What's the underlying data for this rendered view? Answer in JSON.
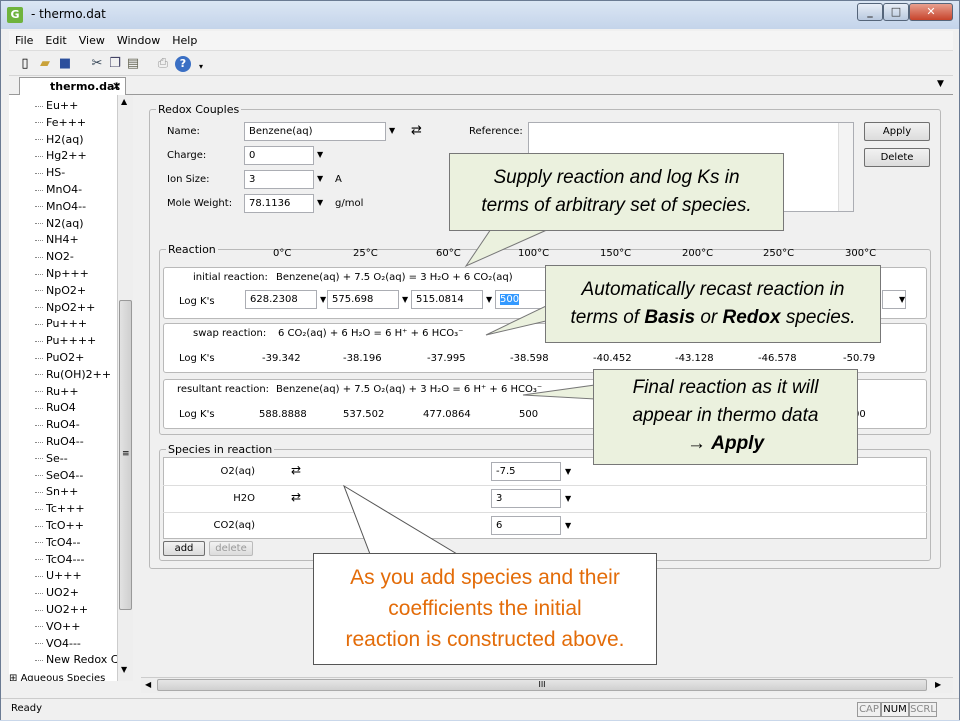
{
  "window": {
    "title": "- thermo.dat",
    "app_icon": "G"
  },
  "menu": [
    "File",
    "Edit",
    "View",
    "Window",
    "Help"
  ],
  "tab": {
    "label": "thermo.dat",
    "close": "✕"
  },
  "sidebar": {
    "items": [
      "Eu++",
      "Fe+++",
      "H2(aq)",
      "Hg2++",
      "HS-",
      "MnO4-",
      "MnO4--",
      "N2(aq)",
      "NH4+",
      "NO2-",
      "Np+++",
      "NpO2+",
      "NpO2++",
      "Pu+++",
      "Pu++++",
      "PuO2+",
      "Ru(OH)2++",
      "Ru++",
      "RuO4",
      "RuO4-",
      "RuO4--",
      "Se--",
      "SeO4--",
      "Sn++",
      "Tc+++",
      "TcO++",
      "TcO4--",
      "TcO4---",
      "U+++",
      "UO2+",
      "UO2++",
      "VO++",
      "VO4---",
      "New Redox C",
      "Aqueous Species"
    ]
  },
  "redox": {
    "legend": "Redox Couples",
    "name_label": "Name:",
    "name_value": "Benzene(aq)",
    "charge_label": "Charge:",
    "charge_value": "0",
    "ionsize_label": "Ion Size:",
    "ionsize_value": "3",
    "ionsize_unit": "A",
    "moleweight_label": "Mole Weight:",
    "moleweight_value": "78.1136",
    "moleweight_unit": "g/mol",
    "reference_label": "Reference:",
    "apply": "Apply",
    "delete": "Delete"
  },
  "reaction": {
    "legend": "Reaction",
    "temps": [
      "0°C",
      "25°C",
      "60°C",
      "100°C",
      "150°C",
      "200°C",
      "250°C",
      "300°C"
    ],
    "initial_label": "initial reaction:",
    "initial_eq": "Benzene(aq)  + 7.5 O₂(aq)  = 3 H₂O  + 6 CO₂(aq)",
    "logk_label": "Log K's",
    "initial_logk": [
      "628.2308",
      "575.698",
      "515.0814",
      "500"
    ],
    "swap_label": "swap reaction:",
    "swap_eq": "6 CO₂(aq)  + 6 H₂O  = 6 H⁺  + 6 HCO₃⁻",
    "swap_logk": [
      "-39.342",
      "-38.196",
      "-37.995",
      "-38.598",
      "-40.452",
      "-43.128",
      "-46.578",
      "-50.79"
    ],
    "result_label": "resultant reaction:",
    "result_eq": "Benzene(aq)  + 7.5 O₂(aq)  + 3 H₂O  = 6 H⁺  + 6 HCO₃⁻",
    "result_logk": [
      "588.8888",
      "537.502",
      "477.0864",
      "500",
      "00"
    ]
  },
  "species": {
    "legend": "Species in reaction",
    "rows": [
      {
        "name": "O2(aq)",
        "coef": "-7.5"
      },
      {
        "name": "H2O",
        "coef": "3"
      },
      {
        "name": "CO2(aq)",
        "coef": "6"
      }
    ],
    "add": "add",
    "delete": "delete"
  },
  "callouts": {
    "c1": [
      "Supply reaction and log Ks in",
      "terms of arbitrary set of species."
    ],
    "c2_line1": "Automatically recast reaction in",
    "c2_pre": "terms of ",
    "c2_basis": "Basis",
    "c2_or": " or ",
    "c2_redox": "Redox",
    "c2_post": " species.",
    "c3_line1": "Final reaction as it will",
    "c3_line2": "appear in thermo data",
    "c3_arrow": "→ ",
    "c3_apply": "Apply",
    "c4": [
      "As you add species and their",
      "coefficients the initial",
      "reaction is constructed above."
    ]
  },
  "hscroll_grip": "III",
  "vscroll_grip": "≡",
  "status": {
    "text": "Ready",
    "indicators": [
      "CAP",
      "NUM",
      "SCRL"
    ]
  },
  "colors": {
    "callout_bg": "#ebf1de",
    "callout_orange": "#e36c09",
    "app_icon": "#6fb33d"
  }
}
